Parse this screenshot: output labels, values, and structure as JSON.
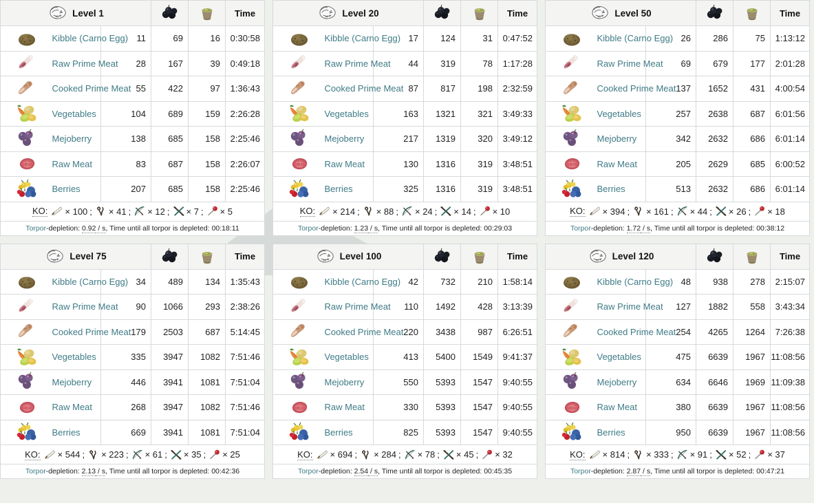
{
  "columns": {
    "title_icon": "dino-head-icon",
    "narcoberry_icon": "narcoberry-icon",
    "narcotic_icon": "narcotic-icon",
    "time_label": "Time"
  },
  "food_items": [
    {
      "icon": "kibble-icon",
      "name": "Kibble (Carno Egg)"
    },
    {
      "icon": "raw-prime-meat-icon",
      "name": "Raw Prime Meat"
    },
    {
      "icon": "cooked-prime-meat-icon",
      "name": "Cooked Prime Meat"
    },
    {
      "icon": "vegetables-icon",
      "name": "Vegetables"
    },
    {
      "icon": "mejoberry-icon",
      "name": "Mejoberry"
    },
    {
      "icon": "raw-meat-icon",
      "name": "Raw Meat"
    },
    {
      "icon": "berries-icon",
      "name": "Berries"
    }
  ],
  "ko": {
    "label": "KO:",
    "weapons": [
      "wooden-club-icon",
      "slingshot-icon",
      "bow-icon",
      "crossbow-icon",
      "tranq-dart-icon"
    ]
  },
  "torpor": {
    "link_text": "Torpor",
    "prefix": "-depletion: ",
    "rate_suffix": " / s",
    "mid_text": ", Time until all torpor is depleted: "
  },
  "colors": {
    "link": "#3f7b86",
    "border": "#a2a9b1",
    "cell_border": "#d6d9dc",
    "header_bg": "#f4f5f3",
    "page_bg": "#eef0ec"
  },
  "tables": [
    {
      "level_label": "Level 1",
      "rows": [
        {
          "food": "11",
          "narcoberry": "69",
          "narcotic": "16",
          "time": "0:30:58"
        },
        {
          "food": "28",
          "narcoberry": "167",
          "narcotic": "39",
          "time": "0:49:18"
        },
        {
          "food": "55",
          "narcoberry": "422",
          "narcotic": "97",
          "time": "1:36:43"
        },
        {
          "food": "104",
          "narcoberry": "689",
          "narcotic": "159",
          "time": "2:26:28"
        },
        {
          "food": "138",
          "narcoberry": "685",
          "narcotic": "158",
          "time": "2:25:46"
        },
        {
          "food": "83",
          "narcoberry": "687",
          "narcotic": "158",
          "time": "2:26:07"
        },
        {
          "food": "207",
          "narcoberry": "685",
          "narcotic": "158",
          "time": "2:25:46"
        }
      ],
      "ko_counts": [
        "100",
        "41",
        "12",
        "7",
        "5"
      ],
      "torpor_rate": "0.92",
      "torpor_time": "00:18:11"
    },
    {
      "level_label": "Level 20",
      "rows": [
        {
          "food": "17",
          "narcoberry": "124",
          "narcotic": "31",
          "time": "0:47:52"
        },
        {
          "food": "44",
          "narcoberry": "319",
          "narcotic": "78",
          "time": "1:17:28"
        },
        {
          "food": "87",
          "narcoberry": "817",
          "narcotic": "198",
          "time": "2:32:59"
        },
        {
          "food": "163",
          "narcoberry": "1321",
          "narcotic": "321",
          "time": "3:49:33"
        },
        {
          "food": "217",
          "narcoberry": "1319",
          "narcotic": "320",
          "time": "3:49:12"
        },
        {
          "food": "130",
          "narcoberry": "1316",
          "narcotic": "319",
          "time": "3:48:51"
        },
        {
          "food": "325",
          "narcoberry": "1316",
          "narcotic": "319",
          "time": "3:48:51"
        }
      ],
      "ko_counts": [
        "214",
        "88",
        "24",
        "14",
        "10"
      ],
      "torpor_rate": "1.23",
      "torpor_time": "00:29:03"
    },
    {
      "level_label": "Level 50",
      "rows": [
        {
          "food": "26",
          "narcoberry": "286",
          "narcotic": "75",
          "time": "1:13:12"
        },
        {
          "food": "69",
          "narcoberry": "679",
          "narcotic": "177",
          "time": "2:01:28"
        },
        {
          "food": "137",
          "narcoberry": "1652",
          "narcotic": "431",
          "time": "4:00:54"
        },
        {
          "food": "257",
          "narcoberry": "2638",
          "narcotic": "687",
          "time": "6:01:56"
        },
        {
          "food": "342",
          "narcoberry": "2632",
          "narcotic": "686",
          "time": "6:01:14"
        },
        {
          "food": "205",
          "narcoberry": "2629",
          "narcotic": "685",
          "time": "6:00:52"
        },
        {
          "food": "513",
          "narcoberry": "2632",
          "narcotic": "686",
          "time": "6:01:14"
        }
      ],
      "ko_counts": [
        "394",
        "161",
        "44",
        "26",
        "18"
      ],
      "torpor_rate": "1.72",
      "torpor_time": "00:38:12"
    },
    {
      "level_label": "Level 75",
      "rows": [
        {
          "food": "34",
          "narcoberry": "489",
          "narcotic": "134",
          "time": "1:35:43"
        },
        {
          "food": "90",
          "narcoberry": "1066",
          "narcotic": "293",
          "time": "2:38:26"
        },
        {
          "food": "179",
          "narcoberry": "2503",
          "narcotic": "687",
          "time": "5:14:45"
        },
        {
          "food": "335",
          "narcoberry": "3947",
          "narcotic": "1082",
          "time": "7:51:46"
        },
        {
          "food": "446",
          "narcoberry": "3941",
          "narcotic": "1081",
          "time": "7:51:04"
        },
        {
          "food": "268",
          "narcoberry": "3947",
          "narcotic": "1082",
          "time": "7:51:46"
        },
        {
          "food": "669",
          "narcoberry": "3941",
          "narcotic": "1081",
          "time": "7:51:04"
        }
      ],
      "ko_counts": [
        "544",
        "223",
        "61",
        "35",
        "25"
      ],
      "torpor_rate": "2.13",
      "torpor_time": "00:42:36"
    },
    {
      "level_label": "Level 100",
      "rows": [
        {
          "food": "42",
          "narcoberry": "732",
          "narcotic": "210",
          "time": "1:58:14"
        },
        {
          "food": "110",
          "narcoberry": "1492",
          "narcotic": "428",
          "time": "3:13:39"
        },
        {
          "food": "220",
          "narcoberry": "3438",
          "narcotic": "987",
          "time": "6:26:51"
        },
        {
          "food": "413",
          "narcoberry": "5400",
          "narcotic": "1549",
          "time": "9:41:37"
        },
        {
          "food": "550",
          "narcoberry": "5393",
          "narcotic": "1547",
          "time": "9:40:55"
        },
        {
          "food": "330",
          "narcoberry": "5393",
          "narcotic": "1547",
          "time": "9:40:55"
        },
        {
          "food": "825",
          "narcoberry": "5393",
          "narcotic": "1547",
          "time": "9:40:55"
        }
      ],
      "ko_counts": [
        "694",
        "284",
        "78",
        "45",
        "32"
      ],
      "torpor_rate": "2.54",
      "torpor_time": "00:45:35"
    },
    {
      "level_label": "Level 120",
      "rows": [
        {
          "food": "48",
          "narcoberry": "938",
          "narcotic": "278",
          "time": "2:15:07"
        },
        {
          "food": "127",
          "narcoberry": "1882",
          "narcotic": "558",
          "time": "3:43:34"
        },
        {
          "food": "254",
          "narcoberry": "4265",
          "narcotic": "1264",
          "time": "7:26:38"
        },
        {
          "food": "475",
          "narcoberry": "6639",
          "narcotic": "1967",
          "time": "11:08:56"
        },
        {
          "food": "634",
          "narcoberry": "6646",
          "narcotic": "1969",
          "time": "11:09:38"
        },
        {
          "food": "380",
          "narcoberry": "6639",
          "narcotic": "1967",
          "time": "11:08:56"
        },
        {
          "food": "950",
          "narcoberry": "6639",
          "narcotic": "1967",
          "time": "11:08:56"
        }
      ],
      "ko_counts": [
        "814",
        "333",
        "91",
        "52",
        "37"
      ],
      "torpor_rate": "2.87",
      "torpor_time": "00:47:21"
    }
  ]
}
